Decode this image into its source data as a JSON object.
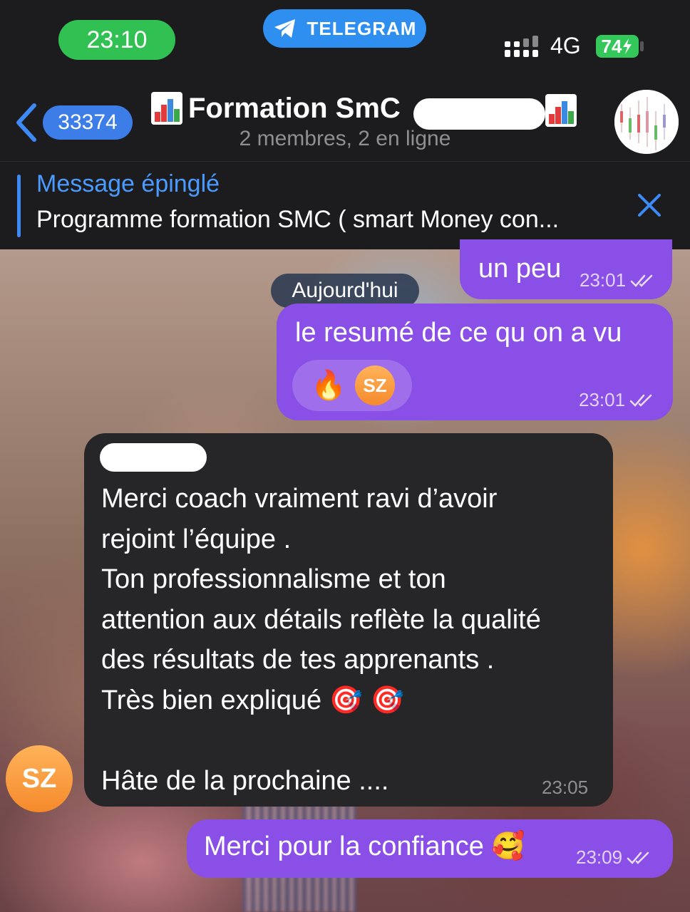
{
  "status": {
    "time": "23:10",
    "app_pill": "TELEGRAM",
    "network": "4G",
    "battery": "74"
  },
  "header": {
    "back_count": "33374",
    "title": "Formation SmC",
    "subtitle": "2 membres, 2 en ligne"
  },
  "pinned": {
    "label": "Message épinglé",
    "text": "Programme formation SMC ( smart Money con..."
  },
  "messages": [
    {
      "dir": "out",
      "text": "un peu",
      "time": "23:01"
    },
    {
      "dir": "date",
      "text": "Aujourd'hui"
    },
    {
      "dir": "out",
      "text": "le resumé de ce qu on a vu",
      "time": "23:01",
      "reaction": {
        "emoji": "🔥",
        "avatar": "SZ"
      }
    },
    {
      "dir": "in",
      "avatar": "SZ",
      "lines": [
        "Merci coach vraiment ravi d’avoir",
        "rejoint l’équipe .",
        "Ton professionnalisme et ton",
        "attention aux détails reflète la qualité",
        "des résultats de tes apprenants .",
        "Très bien expliqué 🎯 🎯",
        "",
        "Hâte de la prochaine ...."
      ],
      "time": "23:05"
    },
    {
      "dir": "out",
      "text": "Merci pour la confiance 🥰",
      "time": "23:09"
    }
  ],
  "colors": {
    "outgoing_bubble": "#8a4fe6",
    "incoming_bubble": "#262628",
    "accent": "#3d8af7",
    "status_green": "#31c152"
  },
  "icons": [
    "back-chevron-icon",
    "telegram-plane-icon",
    "signal-icon",
    "battery-icon",
    "close-icon",
    "double-check-icon",
    "fire-emoji",
    "chart-emoji"
  ]
}
